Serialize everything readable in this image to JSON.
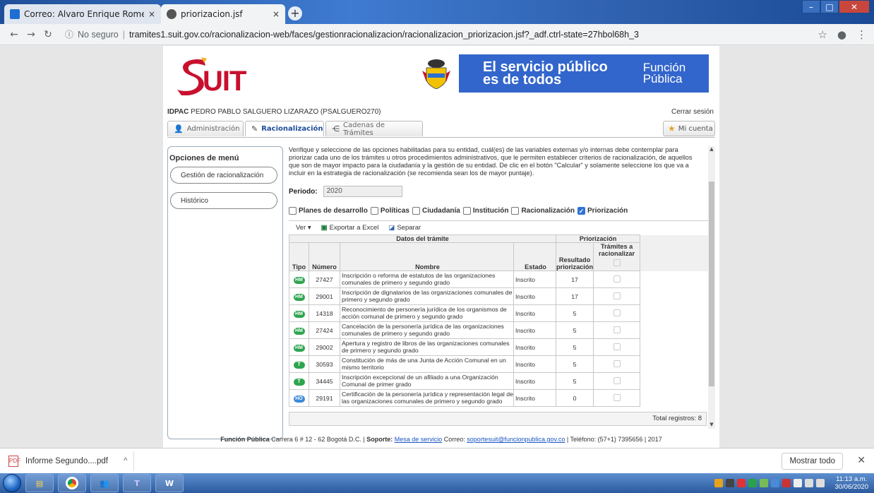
{
  "browser": {
    "tabs": [
      {
        "title": "Correo: Alvaro Enrique Romero C",
        "close": "×"
      },
      {
        "title": "priorizacion.jsf",
        "close": "×"
      }
    ],
    "new_tab": "+",
    "security_label": "No seguro",
    "url": "tramites1.suit.gov.co/racionalizacion-web/faces/gestionracionalizacion/racionalizacion_priorizacion.jsf?_adf.ctrl-state=27hbol68h_3"
  },
  "header": {
    "logo_text": "UIT",
    "gov_line1": "El servicio público",
    "gov_line2": "es de todos",
    "fp_line1": "Función",
    "fp_line2": "Pública"
  },
  "user": {
    "entity": "IDPAC",
    "name": "PEDRO PABLO SALGUERO LIZARAZO (PSALGUERO270)",
    "logout": "Cerrar sesión",
    "my_account": "Mi cuenta"
  },
  "module_tabs": [
    "Administración",
    "Racionalización",
    "Cadenas de Trámites"
  ],
  "menu": {
    "title": "Opciones de menú",
    "items": [
      "Gestión de racionalización",
      "Histórico"
    ]
  },
  "content": {
    "description": "Verifique y seleccione de las opciones habilitadas para su entidad, cuál(es) de las variables externas y/o internas debe contemplar para priorizar cada uno de los trámites u otros procedimientos administrativos, que le permiten establecer criterios de racionalización, de aquellos que son de mayor impacto para la ciudadanía y la gestión de su entidad. De clic en el botón \"Calcular\" y solamente seleccione los que va a incluir en la estrategia de racionalización (se recomienda sean los de mayor puntaje).",
    "period_label": "Periodo:",
    "period_value": "2020",
    "filters": [
      {
        "label": "Planes de desarrollo",
        "checked": false
      },
      {
        "label": "Políticas",
        "checked": false
      },
      {
        "label": "Ciudadanía",
        "checked": false
      },
      {
        "label": "Institución",
        "checked": false
      },
      {
        "label": "Racionalización",
        "checked": false
      },
      {
        "label": "Priorización",
        "checked": true
      }
    ],
    "toolbar": {
      "view": "Ver ▾",
      "export": "Exportar a Excel",
      "detach": "Separar"
    },
    "table": {
      "group1": "Datos del trámite",
      "group2": "Priorización",
      "headers": {
        "tipo": "Tipo",
        "numero": "Número",
        "nombre": "Nombre",
        "estado": "Estado",
        "resultado": "Resultado priorización",
        "tramites": "Trámites a racionalizar"
      },
      "rows": [
        {
          "tipo": "HM",
          "numero": "27427",
          "nombre": "Inscripción o reforma de estatutos de las organizaciones comunales de primero y segundo grado",
          "estado": "Inscrito",
          "resultado": "17"
        },
        {
          "tipo": "HM",
          "numero": "29001",
          "nombre": "Inscripción de dignatarios de las organizaciones comunales de primero y segundo grado",
          "estado": "Inscrito",
          "resultado": "17"
        },
        {
          "tipo": "HM",
          "numero": "14318",
          "nombre": "Reconocimiento de personería jurídica de los organismos de acción comunal de primero y segundo grado",
          "estado": "Inscrito",
          "resultado": "5"
        },
        {
          "tipo": "HM",
          "numero": "27424",
          "nombre": "Cancelación de la personería jurídica de las organizaciones comunales de primero y segundo grado",
          "estado": "Inscrito",
          "resultado": "5"
        },
        {
          "tipo": "HM",
          "numero": "29002",
          "nombre": "Apertura y registro de libros de las organizaciones comunales de primero y segundo grado",
          "estado": "Inscrito",
          "resultado": "5"
        },
        {
          "tipo": "T",
          "numero": "30593",
          "nombre": "Constitución de más de una Junta de Acción Comunal en un mismo territorio",
          "estado": "Inscrito",
          "resultado": "5"
        },
        {
          "tipo": "T",
          "numero": "34445",
          "nombre": "Inscripción excepcional de un afiliado a una Organización Comunal de primer grado",
          "estado": "Inscrito",
          "resultado": "5"
        },
        {
          "tipo": "HO",
          "numero": "29191",
          "nombre": "Certificación de la personería jurídica y representación legal de las organizaciones comunales de primero y segundo grado",
          "estado": "Inscrito",
          "resultado": "0"
        }
      ],
      "total": "Total registros: 8"
    }
  },
  "footer": {
    "org": "Función Pública",
    "address": "Carrera 6 # 12 - 62 Bogotá D.C. |",
    "support_label": "Soporte:",
    "support_link": "Mesa de servicio",
    "mail_label": "Correo:",
    "mail_link": "soportesuit@funcionpublica.gov.co",
    "phone": "| Teléfono: (57+1) 7395656 | 2017"
  },
  "downloads": {
    "file": "Informe Segundo....pdf",
    "show_all": "Mostrar todo"
  },
  "taskbar": {
    "time": "11:13 a.m.",
    "date": "30/06/2020"
  }
}
